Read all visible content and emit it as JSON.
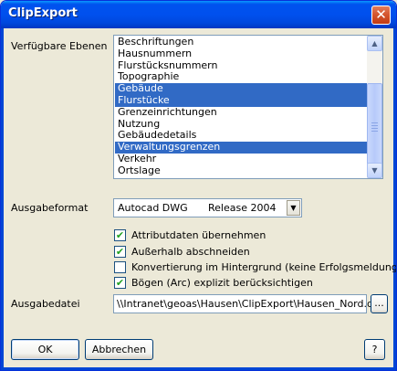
{
  "window": {
    "title": "ClipExport",
    "close_glyph": "✕"
  },
  "layers": {
    "label": "Verfügbare Ebenen",
    "items": [
      {
        "label": "Beschriftungen",
        "selected": false
      },
      {
        "label": "Hausnummern",
        "selected": false
      },
      {
        "label": "Flurstücksnummern",
        "selected": false
      },
      {
        "label": "Topographie",
        "selected": false
      },
      {
        "label": "Gebäude",
        "selected": true
      },
      {
        "label": "Flurstücke",
        "selected": true
      },
      {
        "label": "Grenzeinrichtungen",
        "selected": false
      },
      {
        "label": "Nutzung",
        "selected": false
      },
      {
        "label": "Gebäudedetails",
        "selected": false
      },
      {
        "label": "Verwaltungsgrenzen",
        "selected": true
      },
      {
        "label": "Verkehr",
        "selected": false
      },
      {
        "label": "Ortslage",
        "selected": false
      }
    ]
  },
  "format": {
    "label": "Ausgabeformat",
    "value": "Autocad DWG",
    "release": "Release 2004"
  },
  "options": [
    {
      "label": "Attributdaten übernehmen",
      "checked": true
    },
    {
      "label": "Außerhalb abschneiden",
      "checked": true
    },
    {
      "label": "Konvertierung im Hintergrund (keine Erfolgsmeldung!)",
      "checked": false
    },
    {
      "label": "Bögen (Arc) explizit berücksichtigen",
      "checked": true
    }
  ],
  "output": {
    "label": "Ausgabedatei",
    "value": "\\\\Intranet\\geoas\\Hausen\\ClipExport\\Hausen_Nord.dwg",
    "browse_label": "..."
  },
  "buttons": {
    "ok": "OK",
    "cancel": "Abbrechen",
    "help": "?"
  }
}
